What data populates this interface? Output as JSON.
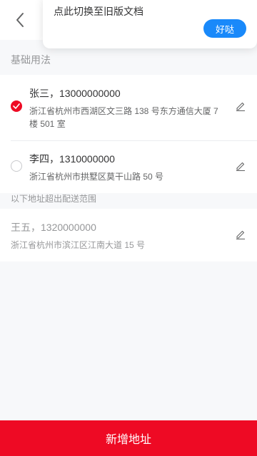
{
  "popover": {
    "text": "点此切换至旧版文档",
    "button_label": "好哒"
  },
  "section": {
    "title": "基础用法"
  },
  "addresses": [
    {
      "name_phone": "张三，13000000000",
      "address": "浙江省杭州市西湖区文三路 138 号东方通信大厦 7 楼 501 室",
      "selected": true
    },
    {
      "name_phone": "李四，1310000000",
      "address": "浙江省杭州市拱墅区莫干山路 50 号",
      "selected": false
    }
  ],
  "disabled_section": {
    "title": "以下地址超出配送范围"
  },
  "disabled_addresses": [
    {
      "name_phone": "王五，1320000000",
      "address": "浙江省杭州市滨江区江南大道 15 号"
    }
  ],
  "footer": {
    "add_button_label": "新增地址"
  },
  "colors": {
    "accent": "#ee0a24",
    "popover_button": "#1989fa"
  },
  "icons": {
    "back": "chevron-left-icon",
    "checked": "check-circle-icon",
    "edit": "edit-pencil-icon"
  }
}
